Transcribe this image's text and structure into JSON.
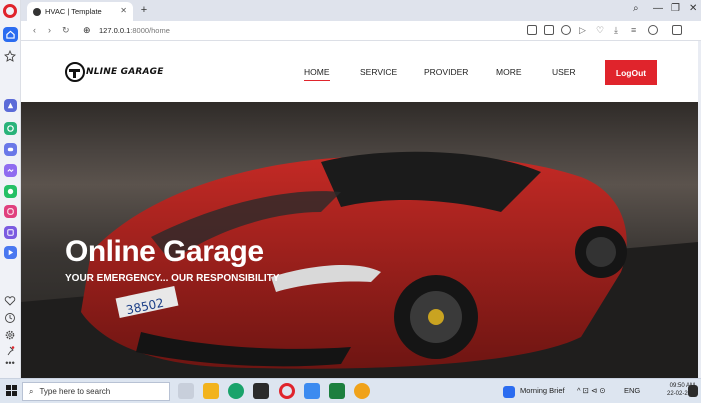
{
  "browser": {
    "tab_title": "HVAC | Template",
    "url_host": "127.0.0.1",
    "url_path": ":8000/home"
  },
  "site": {
    "logo_text": "NLINE GARAGE",
    "nav": [
      {
        "label": "HOME",
        "active": true
      },
      {
        "label": "SERVICE"
      },
      {
        "label": "PROVIDER"
      },
      {
        "label": "MORE"
      },
      {
        "label": "USER"
      }
    ],
    "logout_label": "LogOut",
    "accent": "#e0242c"
  },
  "hero": {
    "title": "Online Garage",
    "subtitle": "YOUR EMERGENCY... OUR RESPONSIBILITY",
    "plate_text": "38502"
  },
  "taskbar": {
    "search_placeholder": "Type here to search",
    "widget_text": "Morning Brief",
    "lang": "ENG",
    "time": "09:50 AM",
    "date": "22-02-2024"
  }
}
